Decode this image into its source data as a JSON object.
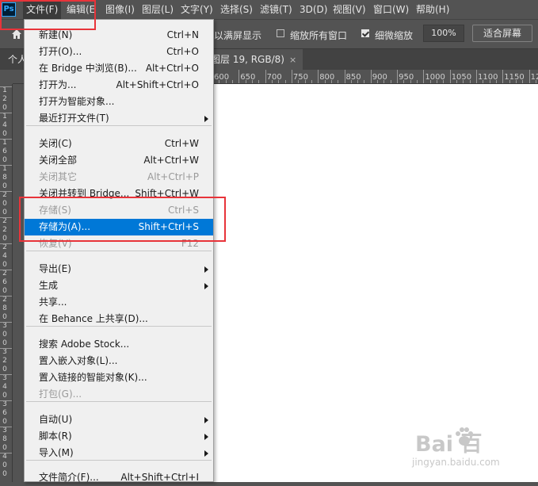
{
  "menubar": {
    "logo": "Ps",
    "items": [
      "文件(F)",
      "编辑(E",
      "图像(I)",
      "图层(L)",
      "文字(Y)",
      "选择(S)",
      "滤镜(T)",
      "3D(D)",
      "视图(V)",
      "窗口(W)",
      "帮助(H)"
    ]
  },
  "options": {
    "fullscreen_partial": "以满屏显示",
    "fit_all_label": "缩放所有窗口",
    "fit_all_checked": false,
    "scrubby_label": "细微缩放",
    "scrubby_checked": true,
    "zoom_value": "100%",
    "fit_screen_button": "适合屏幕"
  },
  "tabs": {
    "partial_left": "个人",
    "doc_title": "图层 19, RGB/8)",
    "close": "×"
  },
  "ruler_h": [
    "600",
    "650",
    "700",
    "750",
    "800",
    "850",
    "900",
    "950",
    "1000",
    "1050",
    "1100",
    "1150",
    "12"
  ],
  "ruler_v": [
    "1",
    "2",
    "0",
    "1",
    "4",
    "0",
    "1",
    "6",
    "0",
    "1",
    "8",
    "0",
    "2",
    "0",
    "0",
    "2",
    "2",
    "0",
    "2",
    "4",
    "0",
    "2",
    "6",
    "0",
    "2",
    "8",
    "0",
    "3",
    "0",
    "0",
    "3",
    "2",
    "0",
    "3",
    "4",
    "0",
    "3",
    "6",
    "0",
    "3",
    "8",
    "0",
    "4",
    "0",
    "0"
  ],
  "file_menu": {
    "items": [
      {
        "label": "新建(N)",
        "shortcut": "Ctrl+N"
      },
      {
        "label": "打开(O)...",
        "shortcut": "Ctrl+O"
      },
      {
        "label": "在 Bridge 中浏览(B)...",
        "shortcut": "Alt+Ctrl+O"
      },
      {
        "label": "打开为...",
        "shortcut": "Alt+Shift+Ctrl+O"
      },
      {
        "label": "打开为智能对象...",
        "shortcut": ""
      },
      {
        "label": "最近打开文件(T)",
        "shortcut": ""
      },
      {
        "label": "关闭(C)",
        "shortcut": "Ctrl+W"
      },
      {
        "label": "关闭全部",
        "shortcut": "Alt+Ctrl+W"
      },
      {
        "label": "关闭其它",
        "shortcut": "Alt+Ctrl+P"
      },
      {
        "label": "关闭并转到 Bridge...",
        "shortcut": "Shift+Ctrl+W"
      },
      {
        "label": "存储(S)",
        "shortcut": "Ctrl+S"
      },
      {
        "label": "存储为(A)...",
        "shortcut": "Shift+Ctrl+S"
      },
      {
        "label": "恢复(V)",
        "shortcut": "F12"
      },
      {
        "label": "导出(E)",
        "shortcut": ""
      },
      {
        "label": "生成",
        "shortcut": ""
      },
      {
        "label": "共享...",
        "shortcut": ""
      },
      {
        "label": "在 Behance 上共享(D)...",
        "shortcut": ""
      },
      {
        "label": "搜索 Adobe Stock...",
        "shortcut": ""
      },
      {
        "label": "置入嵌入对象(L)...",
        "shortcut": ""
      },
      {
        "label": "置入链接的智能对象(K)...",
        "shortcut": ""
      },
      {
        "label": "打包(G)...",
        "shortcut": ""
      },
      {
        "label": "自动(U)",
        "shortcut": ""
      },
      {
        "label": "脚本(R)",
        "shortcut": ""
      },
      {
        "label": "导入(M)",
        "shortcut": ""
      },
      {
        "label": "文件简介(F)...",
        "shortcut": "Alt+Shift+Ctrl+I"
      }
    ]
  },
  "watermark": {
    "brand": "Bai  百",
    "sub": "jingyan.baidu.com"
  },
  "colors": {
    "highlight": "#0078d7",
    "annotation_red": "#e8343a"
  }
}
